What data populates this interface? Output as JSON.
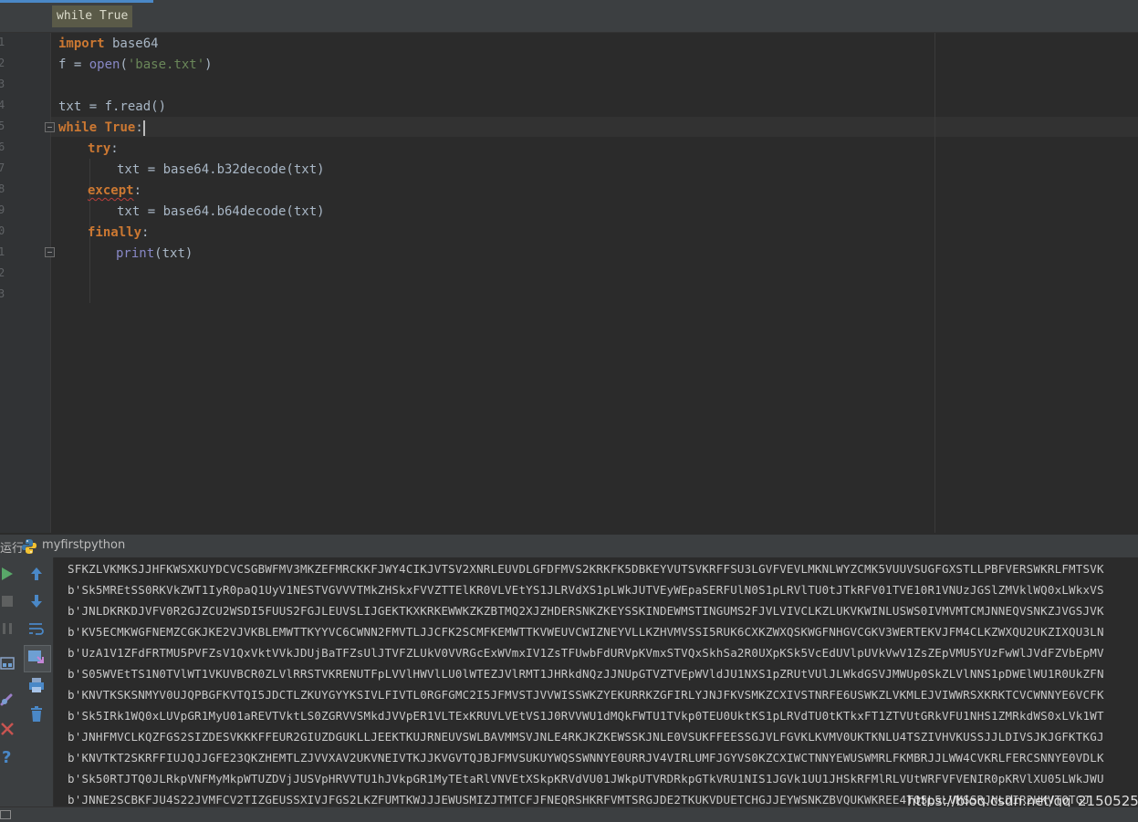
{
  "breadcrumb": "while True",
  "editor": {
    "line_numbers": [
      "1",
      "2",
      "3",
      "4",
      "5",
      "6",
      "7",
      "8",
      "9",
      "0",
      "1",
      "2",
      "3"
    ]
  },
  "code": {
    "l1_kw": "import",
    "l1_rest": " base64",
    "l2_a": "f = ",
    "l2_open": "open",
    "l2_p1": "(",
    "l2_str": "'base.txt'",
    "l2_p2": ")",
    "l4": "txt = f.read()",
    "l5_kw1": "while",
    "l5_kw2": "True",
    "l5_colon": ":",
    "l6_kw": "try",
    "l6_colon": ":",
    "l7": "txt = base64.b32decode(txt)",
    "l8_kw": "except",
    "l8_colon": ":",
    "l9": "txt = base64.b64decode(txt)",
    "l10_kw": "finally",
    "l10_colon": ":",
    "l11_print": "print",
    "l11_rest": "(txt)"
  },
  "run_panel": {
    "label": "运行",
    "config_name": "myfirstpython"
  },
  "console": {
    "lines": [
      "SFKZLVKMKSJJHFKWSXKUYDCVCSGBWFMV3MKZEFMRCKKFJWY4CIKJVTSV2XNRLEUVDLGFDFMVS2KRKFK5DBKEYVUTSVKRFFSU3LGVFVEVLMKNLWYZCMK5VUUVSUGFGXSTLLPBFVERSWKRLFMTSVK",
      "b'Sk5MREtSS0RKVkZWT1IyR0paQ1UyV1NESTVGVVVTMkZHSkxFVVZTTElKR0VLVEtYS1JLRVdXS1pLWkJUTVEyWEpaSERFUlN0S1pLRVlTU0tJTkRFV01TVE10R1VNUzJGSlZMVklWQ0xLWkxVS",
      "b'JNLDKRKDJVFV0R2GJZCU2WSDI5FUUS2FGJLEUVSLIJGEKTKXKRKEWWKZKZBTMQ2XJZHDERSNKZKEYSSKINDEWMSTINGUMS2FJVLVIVCLKZLUKVKWINLUSWS0IVMVMTCMJNNEQVSNKZJVGSJVK",
      "b'KV5ECMKWGFNEMZCGKJKE2VJVKBLEMWTTKYYVC6CWNN2FMVTLJJCFK2SCMFKEMWTTKVWEUVCWIZNEYVLLKZHVMVSSI5RUK6CXKZWXQSKWGFNHGVCGKV3WERTEKVJFM4CLKZWXQU2UKZIXQU3LN",
      "b'UzA1V1ZFdFRTMU5PVFZsV1QxVktVVkJDUjBaTFZsUlJTVFZLUkV0VVRGcExWVmxIV1ZsTFUwbFdURVpKVmxSTVQxSkhSa2R0UXpKSk5VcEdUVlpUVkVwV1ZsZEpVMU5YUzFwWlJVdFZVbEpMV",
      "b'S05WVEtTS1N0TVlWT1VKUVBCR0ZLVlRRSTVKRENUTFpLVVlHWVlLU0lWTEZJVlRMT1JHRkdNQzJJNUpGTVZTVEpWVldJU1NXS1pZRUtVUlJLWkdGSVJMWUp0SkZLVlNNS1pDWElWU1R0UkZFN",
      "b'KNVTKSKSNMYV0UJQPBGFKVTQI5JDCTLZKUYGYYKSIVLFIVTL0RGFGMC2I5JFMVSTJVVWISSWKZYEKURRKZGFIRLYJNJFKVSMKZCXIVSTNRFE6USWKZLVKMLEJVIWWRSXKRKTCVCWNNYE6VCFK",
      "b'Sk5IRk1WQ0xLUVpGR1MyU01aREVTVktLS0ZGRVVSMkdJVVpER1VLTExKRUVLVEtVS1J0RVVWU1dMQkFWTU1TVkp0TEU0UktKS1pLRVdTU0tKTkxFT1ZTVUtGRkVFU1NHS1ZMRkdWS0xLVk1WT",
      "b'JNHFMVCLKQZFGS2SIZDESVKKKFFEUR2GIUZDGUKLLJEEKTKUJRNEUVSWLBAVMMSVJNLE4RKJKZKEWSSKJNLE0VSUKFFEESSGJVLFGVKLKVMV0UKTKNLU4TSZIVHVKUSSJJLDIVSJKJGFKTKGJ",
      "b'KNVTKT2SKRFFIUJQJJGFE23QKZHEMTLZJVVXAV2UKVNEIVTKJJKVGVTQJBJFMVSUKUYWQSSWNNYE0URRJV4VIRLUMFJGYVS0KZCXIWCTNNYEWUSWMRLFKMBRJJLWW4CVKRLFERCSNNYE0VDLK",
      "b'Sk50RTJTQ0JLRkpVNFMyMkpWTUZDVjJUSVpHRVVTU1hJVkpGR1MyTEtaRlVNVEtXSkpKRVdVU01JWkpUTVRDRkpGTkVRU1NIS1JGVk1UU1JHSkRFMlRLVUtWRFVFVENIR0pKRVlXU05LWkJWU",
      "b'JNNE2SCBKFJU4S22JVMFCV2TIZGEUSSXIVJFGS2LKZFUMTKWJJJEWUSMIZJTMTCFJFNEQRSHKRFVMTSRGJDE2TKUKVDUETCHGJJEYWSNKZBVQUKWKREE4TQSL5LVMSSRJNLDIR2HKVTOTGJ"
    ]
  },
  "watermark": "https://blog.csdn.net/qq_21505255"
}
